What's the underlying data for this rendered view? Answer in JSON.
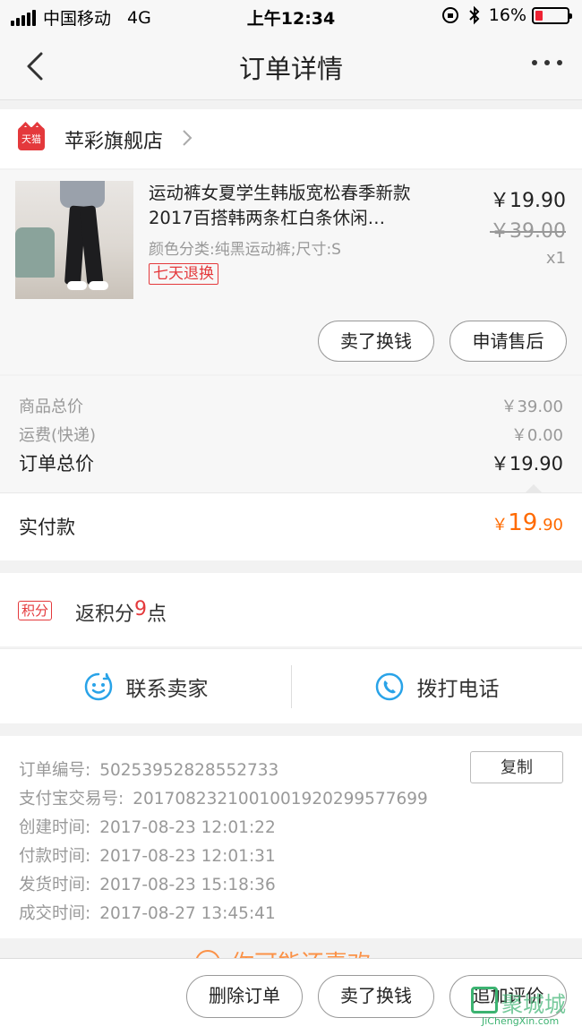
{
  "status_bar": {
    "carrier": "中国移动",
    "network": "4G",
    "time": "上午12:34",
    "battery": "16%",
    "battery_level": 0.16
  },
  "nav": {
    "title": "订单详情"
  },
  "shop": {
    "badge": "天猫",
    "name": "苹彩旗舰店"
  },
  "item": {
    "title": "运动裤女夏学生韩版宽松春季新款2017百搭韩两条杠白条休闲…",
    "spec": "颜色分类:纯黑运动裤;尺寸:S",
    "tag": "七天退换",
    "price_now": "￥19.90",
    "price_old": "￥39.00",
    "qty": "x1"
  },
  "item_actions": {
    "sell": "卖了换钱",
    "after_sale": "申请售后"
  },
  "summary": {
    "goods_label": "商品总价",
    "goods_value": "￥39.00",
    "shipping_label": "运费(快递)",
    "shipping_value": "￥0.00",
    "total_label": "订单总价",
    "total_value": "￥19.90"
  },
  "paid": {
    "label": "实付款",
    "currency": "￥",
    "int": "19",
    "dec": ".90"
  },
  "points": {
    "badge": "积分",
    "prefix": "返积分",
    "count": "9",
    "suffix": "点"
  },
  "contact": {
    "seller": "联系卖家",
    "phone": "拨打电话"
  },
  "info": {
    "copy_button": "复制",
    "rows": [
      {
        "label": "订单编号:",
        "value": "50253952828552733"
      },
      {
        "label": "支付宝交易号:",
        "value": "2017082321001001920299577699"
      },
      {
        "label": "创建时间:",
        "value": "2017-08-23 12:01:22"
      },
      {
        "label": "付款时间:",
        "value": "2017-08-23 12:01:31"
      },
      {
        "label": "发货时间:",
        "value": "2017-08-23 15:18:36"
      },
      {
        "label": "成交时间:",
        "value": "2017-08-27 13:45:41"
      }
    ]
  },
  "promo": {
    "text": "你可能还喜欢"
  },
  "bottom_actions": {
    "delete": "删除订单",
    "sell": "卖了换钱",
    "review": "追加评价"
  },
  "watermark": {
    "text": "聚城城",
    "url": "JiChengXin.com"
  },
  "colors": {
    "accent": "#ff6a00",
    "tmall_red": "#e4393c",
    "icon_blue": "#29a3e8"
  },
  "icons": [
    "back-icon",
    "more-icon",
    "tmall-icon",
    "chevron-right-icon",
    "chat-icon",
    "phone-icon"
  ]
}
